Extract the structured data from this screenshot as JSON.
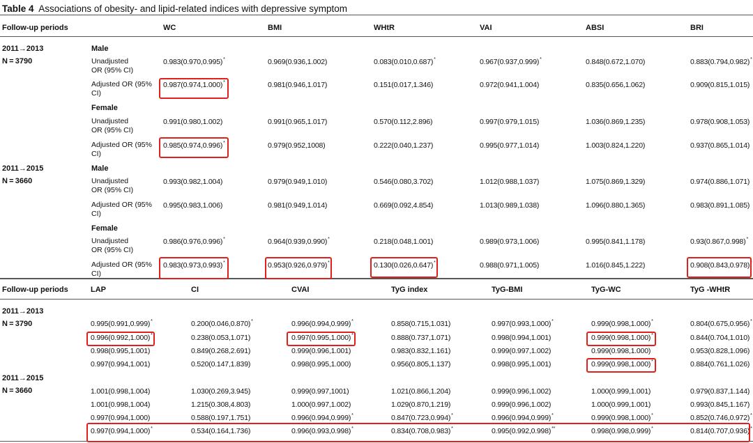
{
  "title": {
    "bold": "Table 4",
    "text": "Associations of obesity- and lipid-related indices with depressive symptom"
  },
  "top": {
    "header": {
      "period": "Follow-up periods",
      "cols": [
        "WC",
        "BMI",
        "WHtR",
        "VAI",
        "ABSI",
        "BRI"
      ]
    },
    "periods": [
      {
        "period": "2011→2013",
        "n": "N = 3790",
        "groups": [
          {
            "sex": "Male",
            "rows": [
              {
                "label1": "Unadjusted",
                "label2": "OR (95% CI)",
                "cells": [
                  [
                    "0.983(0.970,0.995)",
                    "*"
                  ],
                  [
                    "0.969(0.936,1.002)",
                    ""
                  ],
                  [
                    "0.083(0.010,0.687)",
                    "*"
                  ],
                  [
                    "0.967(0.937,0.999)",
                    "*"
                  ],
                  [
                    "0.848(0.672,1.070)",
                    ""
                  ],
                  [
                    "0.883(0.794,0.982)",
                    "*"
                  ]
                ]
              },
              {
                "label1": "Adjusted OR (95%",
                "label2": "CI)",
                "cells": [
                  [
                    "0.987(0.974,1.000)",
                    "*"
                  ],
                  [
                    "0.981(0.946,1.017)",
                    ""
                  ],
                  [
                    "0.151(0.017,1.346)",
                    ""
                  ],
                  [
                    "0.972(0.941,1.004)",
                    ""
                  ],
                  [
                    "0.835(0.656,1.062)",
                    ""
                  ],
                  [
                    "0.909(0.815,1.015)",
                    ""
                  ]
                ]
              }
            ]
          },
          {
            "sex": "Female",
            "rows": [
              {
                "label1": "Unadjusted",
                "label2": "OR (95% CI)",
                "cells": [
                  [
                    "0.991(0.980,1.002)",
                    ""
                  ],
                  [
                    "0.991(0.965,1.017)",
                    ""
                  ],
                  [
                    "0.570(0.112,2.896)",
                    ""
                  ],
                  [
                    "0.997(0.979,1.015)",
                    ""
                  ],
                  [
                    "1.036(0.869,1.235)",
                    ""
                  ],
                  [
                    "0.978(0.908,1.053)",
                    ""
                  ]
                ]
              },
              {
                "label1": "Adjusted OR (95%",
                "label2": "CI)",
                "cells": [
                  [
                    "0.985(0.974,0.996)",
                    "*"
                  ],
                  [
                    "0.979(0.952,1008)",
                    ""
                  ],
                  [
                    "0.222(0.040,1.237)",
                    ""
                  ],
                  [
                    "0.995(0.977,1.014)",
                    ""
                  ],
                  [
                    "1.003(0.824,1.220)",
                    ""
                  ],
                  [
                    "0.937(0.865,1.014)",
                    ""
                  ]
                ]
              }
            ]
          }
        ]
      },
      {
        "period": "2011→2015",
        "n": "N = 3660",
        "groups": [
          {
            "sex": "Male",
            "rows": [
              {
                "label1": "Unadjusted",
                "label2": "OR (95% CI)",
                "cells": [
                  [
                    "0.993(0.982,1.004)",
                    ""
                  ],
                  [
                    "0.979(0.949,1.010)",
                    ""
                  ],
                  [
                    "0.546(0.080,3.702)",
                    ""
                  ],
                  [
                    "1.012(0.988,1.037)",
                    ""
                  ],
                  [
                    "1.075(0.869,1.329)",
                    ""
                  ],
                  [
                    "0.974(0.886,1.071)",
                    ""
                  ]
                ]
              },
              {
                "label1": "Adjusted OR (95%",
                "label2": "CI)",
                "cells": [
                  [
                    "0.995(0.983,1.006)",
                    ""
                  ],
                  [
                    "0.981(0.949,1.014)",
                    ""
                  ],
                  [
                    "0.669(0.092,4.854)",
                    ""
                  ],
                  [
                    "1.013(0.989,1.038)",
                    ""
                  ],
                  [
                    "1.096(0.880,1.365)",
                    ""
                  ],
                  [
                    "0.983(0.891,1.085)",
                    ""
                  ]
                ]
              }
            ]
          },
          {
            "sex": "Female",
            "rows": [
              {
                "label1": "Unadjusted",
                "label2": "OR (95% CI)",
                "cells": [
                  [
                    "0.986(0.976,0.996)",
                    "*"
                  ],
                  [
                    "0.964(0.939,0.990)",
                    "*"
                  ],
                  [
                    "0.218(0.048,1.001)",
                    ""
                  ],
                  [
                    "0.989(0.973,1.006)",
                    ""
                  ],
                  [
                    "0.995(0.841,1.178)",
                    ""
                  ],
                  [
                    "0.93(0.867,0.998)",
                    "*"
                  ]
                ]
              },
              {
                "label1": "Adjusted OR (95%",
                "label2": "CI)",
                "cells": [
                  [
                    "0.983(0.973,0.993)",
                    "*"
                  ],
                  [
                    "0.953(0.926,0.979)",
                    "*"
                  ],
                  [
                    "0.130(0.026,0.647)",
                    "*"
                  ],
                  [
                    "0.988(0.971,1.005)",
                    ""
                  ],
                  [
                    "1.016(0.845,1.222)",
                    ""
                  ],
                  [
                    "0.908(0.843,0.978)",
                    "*"
                  ]
                ]
              }
            ]
          }
        ]
      }
    ]
  },
  "bottom": {
    "header": {
      "period": "Follow-up periods",
      "cols": [
        "LAP",
        "CI",
        "CVAI",
        "TyG index",
        "TyG-BMI",
        "TyG-WC",
        "TyG -WHtR"
      ]
    },
    "periods": [
      {
        "period": "2011→2013",
        "n": "N = 3790",
        "rows": [
          [
            [
              "0.995(0.991,0.999)",
              "*"
            ],
            [
              "0.200(0.046,0.870)",
              "*"
            ],
            [
              "0.996(0.994,0.999)",
              "*"
            ],
            [
              "0.858(0.715,1.031)",
              ""
            ],
            [
              "0.997(0.993,1.000)",
              "*"
            ],
            [
              "0.999(0.998,1.000)",
              "*"
            ],
            [
              "0.804(0.675,0.956)",
              "*"
            ]
          ],
          [
            [
              "0.996(0.992,1.000)",
              "*"
            ],
            [
              "0.238(0.053,1.071)",
              ""
            ],
            [
              "0.997(0.995,1.000)",
              "*"
            ],
            [
              "0.888(0.737,1.071)",
              ""
            ],
            [
              "0.998(0.994,1.001)",
              ""
            ],
            [
              "0.999(0.998,1.000)",
              "*"
            ],
            [
              "0.844(0.704,1.010)",
              ""
            ]
          ],
          [
            [
              "0.998(0.995,1.001)",
              ""
            ],
            [
              "0.849(0.268,2.691)",
              ""
            ],
            [
              "0.999(0.996,1.001)",
              ""
            ],
            [
              "0.983(0.832,1.161)",
              ""
            ],
            [
              "0.999(0.997,1.002)",
              ""
            ],
            [
              "0.999(0.998,1.000)",
              ""
            ],
            [
              "0.953(0.828,1.096)",
              ""
            ]
          ],
          [
            [
              "0.997(0.994,1.001)",
              ""
            ],
            [
              "0.520(0.147,1.839)",
              ""
            ],
            [
              "0.998(0.995,1.000)",
              ""
            ],
            [
              "0.956(0.805,1.137)",
              ""
            ],
            [
              "0.998(0.995,1.001)",
              ""
            ],
            [
              "0.999(0.998,1.000)",
              "*"
            ],
            [
              "0.884(0.761,1.026)",
              ""
            ]
          ]
        ]
      },
      {
        "period": "2011→2015",
        "n": "N = 3660",
        "rows": [
          [
            [
              "1.001(0.998,1.004)",
              ""
            ],
            [
              "1.030(0.269,3.945)",
              ""
            ],
            [
              "0.999(0.997,1001)",
              ""
            ],
            [
              "1.021(0.866,1.204)",
              ""
            ],
            [
              "0.999(0.996,1.002)",
              ""
            ],
            [
              "1.000(0.999,1.001)",
              ""
            ],
            [
              "0.979(0.837,1.144)",
              ""
            ]
          ],
          [
            [
              "1.001(0.998,1.004)",
              ""
            ],
            [
              "1.215(0.308,4.803)",
              ""
            ],
            [
              "1.000(0.997,1.002)",
              ""
            ],
            [
              "1.029(0.870,1.219)",
              ""
            ],
            [
              "0.999(0.996,1.002)",
              ""
            ],
            [
              "1.000(0.999,1.001)",
              ""
            ],
            [
              "0.993(0.845,1.167)",
              ""
            ]
          ],
          [
            [
              "0.997(0.994,1.000)",
              ""
            ],
            [
              "0.588(0.197,1.751)",
              ""
            ],
            [
              "0.996(0.994,0.999)",
              "*"
            ],
            [
              "0.847(0.723,0.994)",
              "*"
            ],
            [
              "0.996(0.994,0.999)",
              "*"
            ],
            [
              "0.999(0.998,1.000)",
              "*"
            ],
            [
              "0.852(0.746,0.972)",
              "*"
            ]
          ],
          [
            [
              "0.997(0.994,1.000)",
              "*"
            ],
            [
              "0.534(0.164,1.736)",
              ""
            ],
            [
              "0.996(0.993,0.998)",
              "*"
            ],
            [
              "0.834(0.708,0.983)",
              "*"
            ],
            [
              "0.995(0.992,0.998)",
              "**"
            ],
            [
              "0.998(0.998,0.999)",
              "*"
            ],
            [
              "0.814(0.707,0.936)",
              "*"
            ]
          ]
        ]
      }
    ]
  },
  "colors": {
    "highlight": "#e0201c",
    "rule": "#555555"
  }
}
